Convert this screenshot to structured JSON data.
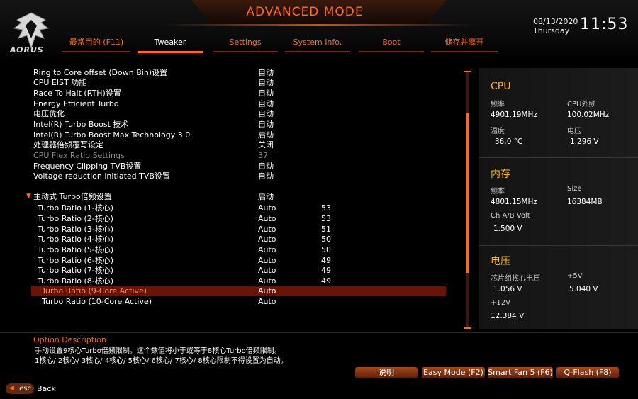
{
  "header": {
    "brand": "AORUS",
    "mode_title": "ADVANCED MODE",
    "date": "08/13/2020",
    "weekday": "Thursday",
    "time": "11:53"
  },
  "tabs": [
    {
      "label": "最常用的 (F11)",
      "active": false
    },
    {
      "label": "Tweaker",
      "active": true
    },
    {
      "label": "Settings",
      "active": false
    },
    {
      "label": "System Info.",
      "active": false
    },
    {
      "label": "Boot",
      "active": false
    },
    {
      "label": "储存并离开",
      "active": false
    }
  ],
  "settings": [
    {
      "label": "Ring to Core offset (Down Bin)设置",
      "value": "自动",
      "value2": ""
    },
    {
      "label": "CPU EIST 功能",
      "value": "自动",
      "value2": ""
    },
    {
      "label": "Race To Halt (RTH)设置",
      "value": "自动",
      "value2": ""
    },
    {
      "label": "Energy Efficient Turbo",
      "value": "自动",
      "value2": ""
    },
    {
      "label": "电压优化",
      "value": "自动",
      "value2": ""
    },
    {
      "label": "Intel(R) Turbo Boost 技术",
      "value": "自动",
      "value2": ""
    },
    {
      "label": "Intel(R) Turbo Boost Max Technology 3.0",
      "value": "启动",
      "value2": ""
    },
    {
      "label": "处理器倍频覆写设定",
      "value": "关闭",
      "value2": ""
    },
    {
      "label": "CPU Flex Ratio Settings",
      "value": "37",
      "value2": ""
    },
    {
      "label": "Frequency Clipping TVB设置",
      "value": "自动",
      "value2": ""
    },
    {
      "label": "Voltage reduction initiated TVB设置",
      "value": "自动",
      "value2": ""
    },
    {
      "label": "主动式 Turbo倍频设置",
      "value": "启动",
      "value2": ""
    },
    {
      "label": "Turbo Ratio (1-核心)",
      "value": "Auto",
      "value2": "53"
    },
    {
      "label": "Turbo Ratio (2-核心)",
      "value": "Auto",
      "value2": "53"
    },
    {
      "label": "Turbo Ratio (3-核心)",
      "value": "Auto",
      "value2": "51"
    },
    {
      "label": "Turbo Ratio (4-核心)",
      "value": "Auto",
      "value2": "50"
    },
    {
      "label": "Turbo Ratio (5-核心)",
      "value": "Auto",
      "value2": "50"
    },
    {
      "label": "Turbo Ratio (6-核心)",
      "value": "Auto",
      "value2": "49"
    },
    {
      "label": "Turbo Ratio (7-核心)",
      "value": "Auto",
      "value2": "49"
    },
    {
      "label": "Turbo Ratio (8-核心)",
      "value": "Auto",
      "value2": "49"
    },
    {
      "label": "Turbo Ratio (9-Core Active)",
      "value": "Auto",
      "value2": ""
    },
    {
      "label": "Turbo Ratio (10-Core Active)",
      "value": "Auto",
      "value2": ""
    }
  ],
  "panel": {
    "cpu": {
      "title": "CPU",
      "freq_label": "频率",
      "freq": "4901.19MHz",
      "ext_label": "CPU外频",
      "ext": "100.02MHz",
      "temp_label": "温度",
      "temp": "36.0 °C",
      "volt_label": "电压",
      "volt": "1.296 V"
    },
    "memory": {
      "title": "内存",
      "freq_label": "频率",
      "freq": "4801.15MHz",
      "size_label": "Size",
      "size": "16384MB",
      "chv_label": "Ch A/B Volt",
      "chv": "1.500 V"
    },
    "voltage": {
      "title": "电压",
      "pch_label": "芯片组核心电压",
      "pch": "1.056 V",
      "v5_label": "+5V",
      "v5": "5.040 V",
      "v12_label": "+12V",
      "v12": "12.384 V"
    }
  },
  "description": {
    "title": "Option Description",
    "line1": "手动设置9核心Turbo倍频限制。这个数值将小于或等于8核心Turbo倍频限制。",
    "line2": "1核心/ 2核心/ 3核心/ 4核心/ 5核心/ 6核心/ 7核心/ 8核心限制不得设置为自动。"
  },
  "footer": {
    "help": "说明",
    "easy_mode": "Easy Mode (F2)",
    "smart_fan": "Smart Fan 5 (F6)",
    "qflash": "Q-Flash (F8)",
    "esc": "esc",
    "back": "Back"
  },
  "colors": {
    "accent": "#ff6a1c",
    "highlight": "#6a1408",
    "panel_title": "#ffb21c"
  }
}
